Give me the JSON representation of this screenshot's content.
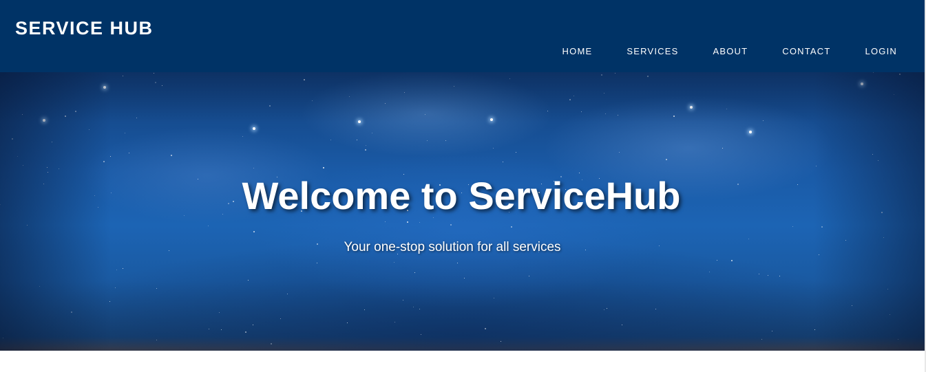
{
  "header": {
    "brand": "SERVICE HUB",
    "nav": [
      {
        "label": "HOME"
      },
      {
        "label": "SERVICES"
      },
      {
        "label": "ABOUT"
      },
      {
        "label": "CONTACT"
      },
      {
        "label": "LOGIN"
      }
    ]
  },
  "hero": {
    "title": "Welcome to ServiceHub",
    "subtitle": "Your one-stop solution for all services"
  },
  "colors": {
    "navbar_background": "#003366",
    "text": "#ffffff",
    "page_background": "#ffffff"
  }
}
